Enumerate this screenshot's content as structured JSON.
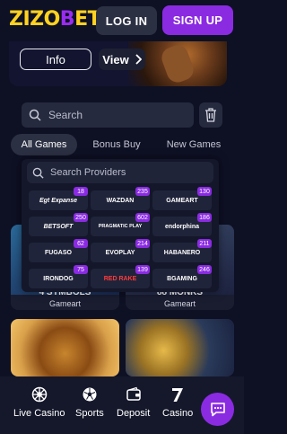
{
  "header": {
    "logo": {
      "part1": "ZIZO",
      "part2": "B",
      "part3": "ET"
    },
    "login_label": "LOG IN",
    "signup_label": "SIGN UP"
  },
  "banner": {
    "info_label": "Info",
    "view_label": "View"
  },
  "search": {
    "placeholder": "Search"
  },
  "tabs": [
    {
      "label": "All Games",
      "active": true
    },
    {
      "label": "Bonus Buy",
      "active": false
    },
    {
      "label": "New Games",
      "active": false
    }
  ],
  "providers": {
    "search_placeholder": "Search Providers",
    "items": [
      {
        "name": "Egt Expanse",
        "count": "18"
      },
      {
        "name": "WAZDAN",
        "count": "235"
      },
      {
        "name": "GAMEART",
        "count": "130"
      },
      {
        "name": "BETSOFT",
        "count": "250"
      },
      {
        "name": "PRAGMATIC PLAY",
        "count": "602"
      },
      {
        "name": "endorphina",
        "count": "186"
      },
      {
        "name": "FUGASO",
        "count": "62"
      },
      {
        "name": "EVOPLAY",
        "count": "214"
      },
      {
        "name": "HABANERO",
        "count": "211"
      },
      {
        "name": "IRONDOG",
        "count": "75"
      },
      {
        "name": "RED RAKE",
        "count": "139"
      },
      {
        "name": "BGAMING",
        "count": "246"
      }
    ]
  },
  "games": [
    {
      "title": "4 SYMBOLS",
      "provider": "Gameart"
    },
    {
      "title": "88 MONKS",
      "provider": "Gameart"
    },
    {
      "title": "",
      "provider": ""
    },
    {
      "title": "",
      "provider": ""
    }
  ],
  "bottom_nav": [
    {
      "label": "Live Casino",
      "icon": "roulette-icon"
    },
    {
      "label": "Sports",
      "icon": "soccer-ball-icon"
    },
    {
      "label": "Deposit",
      "icon": "wallet-icon"
    },
    {
      "label": "Casino",
      "icon": "seven-icon"
    }
  ],
  "colors": {
    "accent": "#8a2be2",
    "logo_yellow": "#ffd21f",
    "background": "#0e1024"
  }
}
